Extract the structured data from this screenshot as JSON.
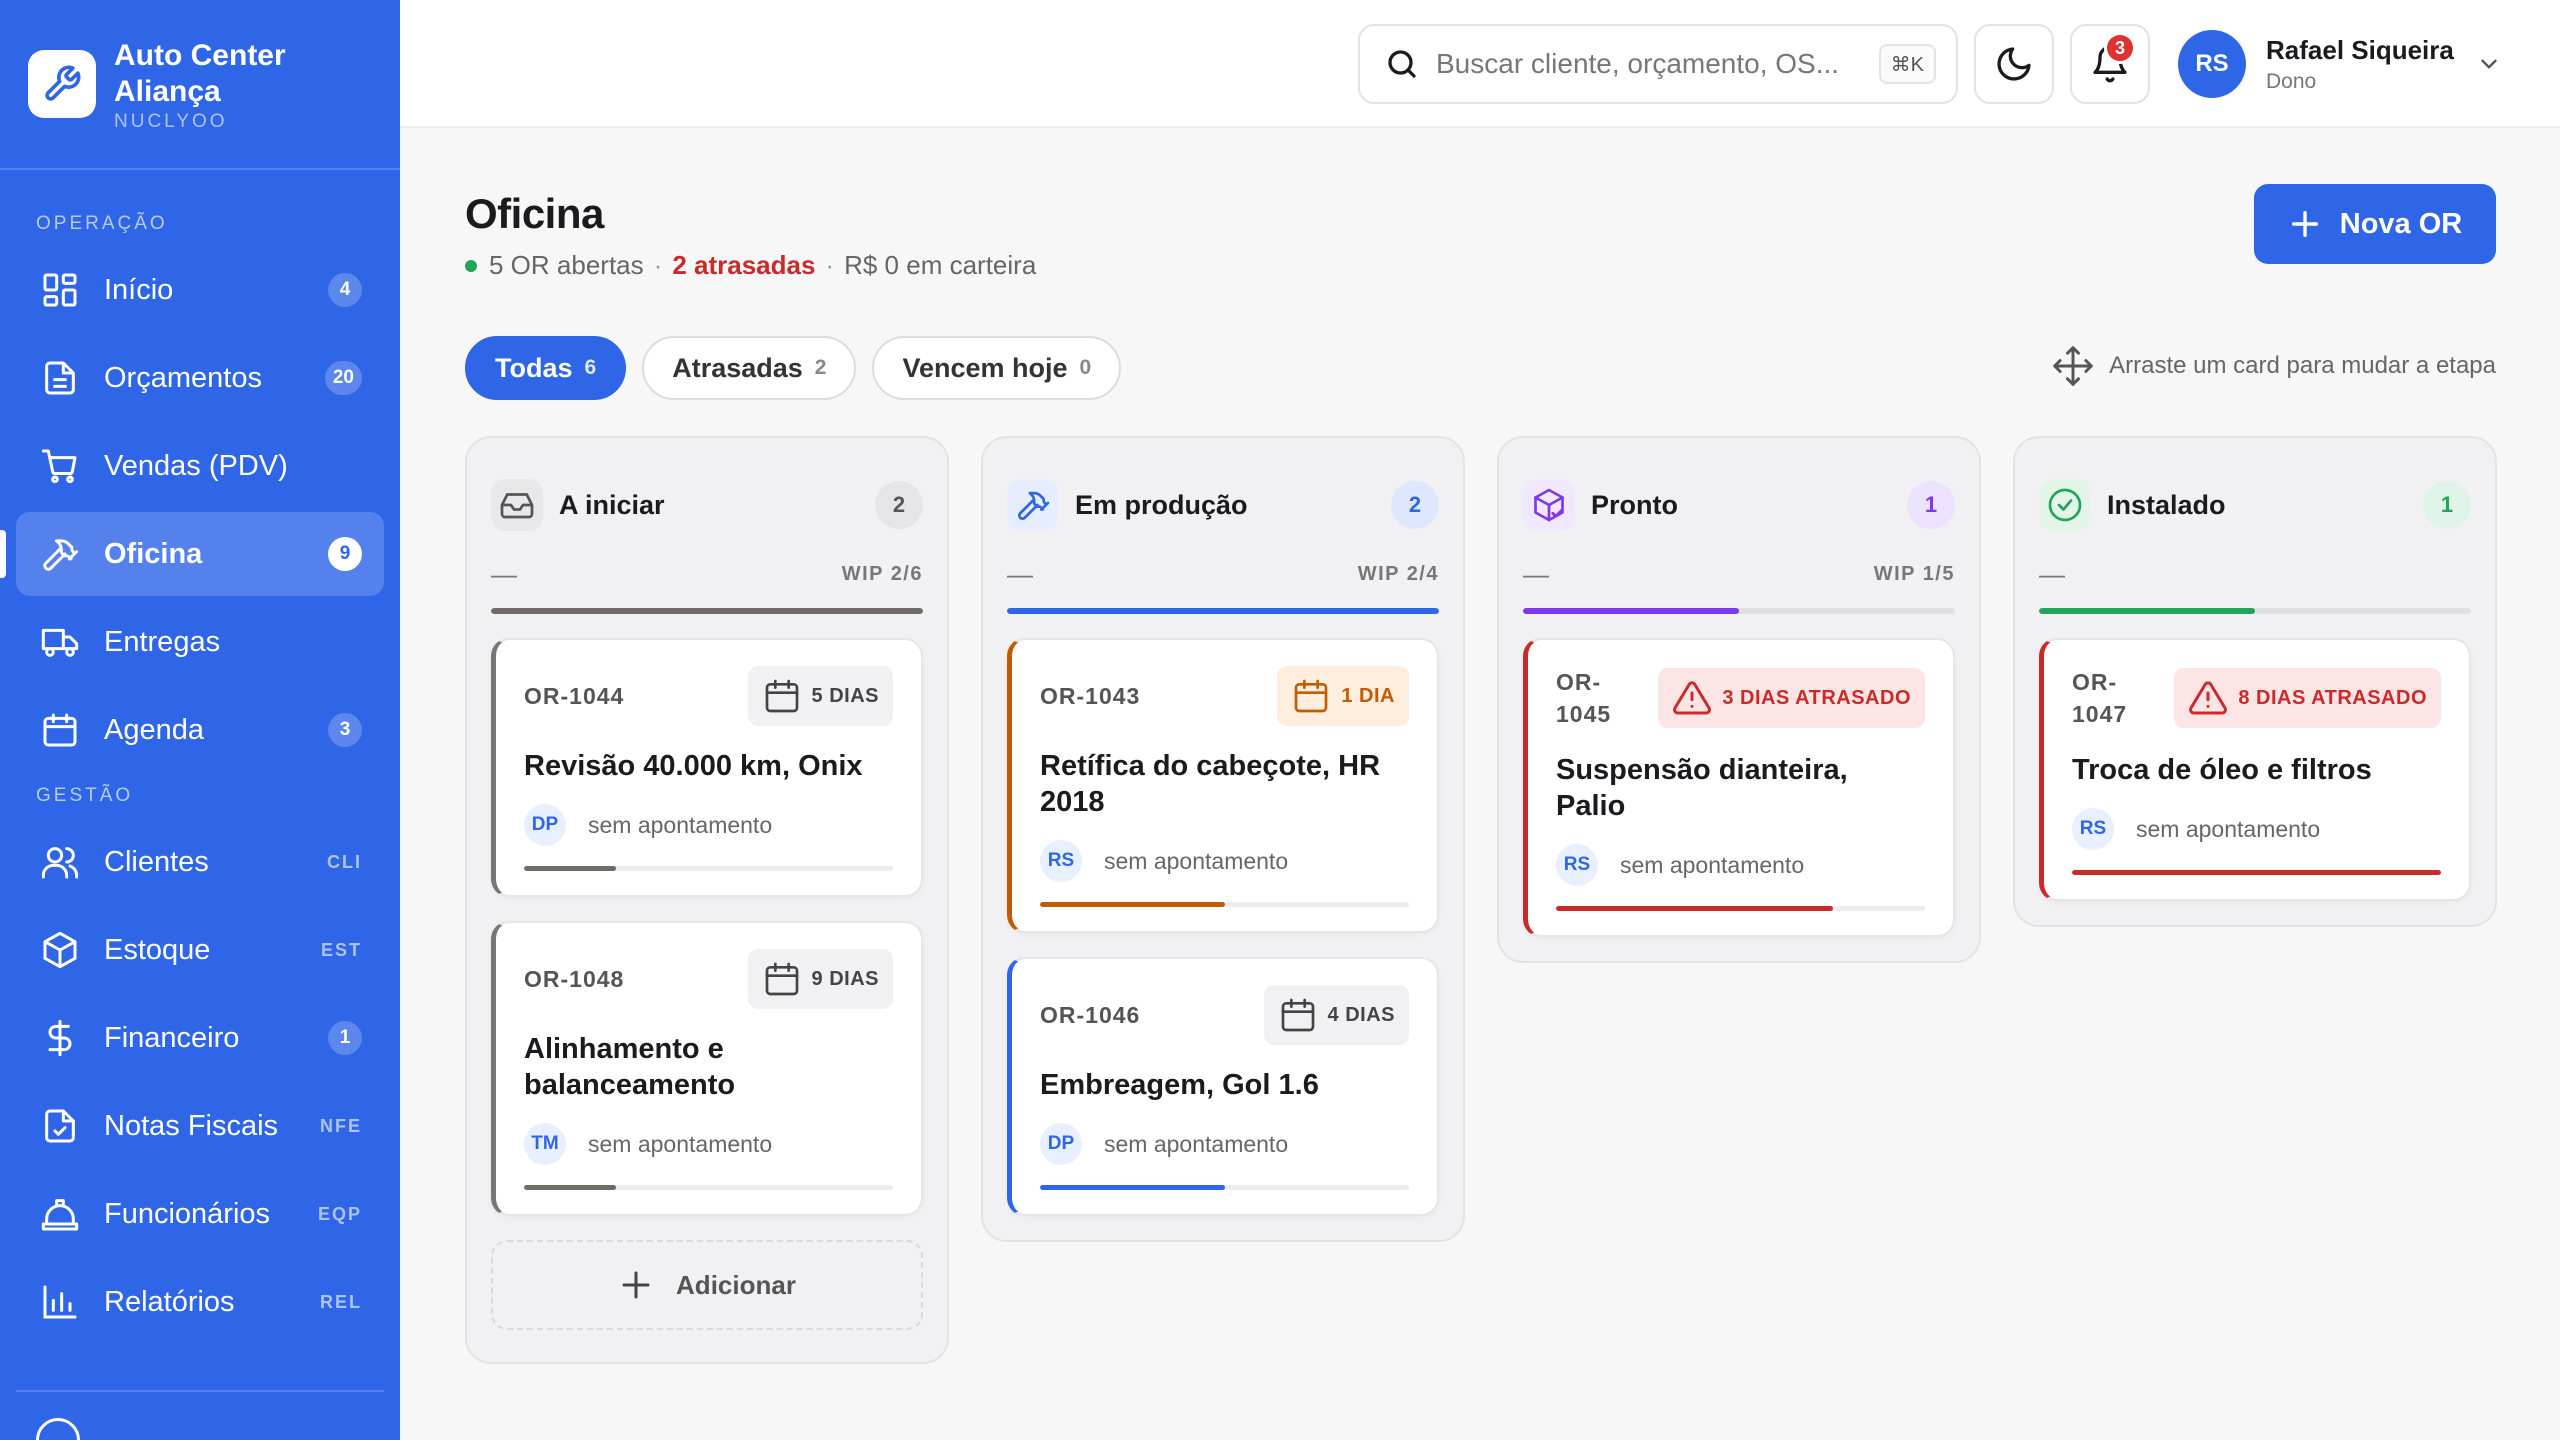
{
  "brand": {
    "name": "Auto Center Aliança",
    "sub": "NUCLYOO"
  },
  "sidebar": {
    "section_ops": "OPERAÇÃO",
    "section_mgmt": "GESTÃO",
    "items": [
      {
        "label": "Início",
        "badge": "4"
      },
      {
        "label": "Orçamentos",
        "badge": "20"
      },
      {
        "label": "Vendas (PDV)"
      },
      {
        "label": "Oficina",
        "badge": "9"
      },
      {
        "label": "Entregas"
      },
      {
        "label": "Agenda",
        "badge": "3"
      },
      {
        "label": "Clientes",
        "code": "CLI"
      },
      {
        "label": "Estoque",
        "code": "EST"
      },
      {
        "label": "Financeiro",
        "badge": "1"
      },
      {
        "label": "Notas Fiscais",
        "code": "NFE"
      },
      {
        "label": "Funcionários",
        "code": "EQP"
      },
      {
        "label": "Relatórios",
        "code": "REL"
      }
    ]
  },
  "topbar": {
    "search_placeholder": "Buscar cliente, orçamento, OS...",
    "search_kbd": "⌘K",
    "notif_count": "3",
    "user": {
      "initials": "RS",
      "name": "Rafael Siqueira",
      "role": "Dono"
    }
  },
  "page": {
    "title": "Oficina",
    "meta_open": "5 OR abertas",
    "meta_sep": "·",
    "meta_late": "2 atrasadas",
    "meta_wallet": "R$ 0 em carteira",
    "new_button": "Nova OR",
    "drag_hint": "Arraste um card para mudar a etapa"
  },
  "filters": [
    {
      "label": "Todas",
      "count": "6"
    },
    {
      "label": "Atrasadas",
      "count": "2"
    },
    {
      "label": "Vencem hoje",
      "count": "0"
    }
  ],
  "colors": {
    "primary": "#2f66e8",
    "danger": "#c92a2a",
    "warn": "#c25c00",
    "success": "#22a559",
    "purple": "#7c3aed",
    "neutral": "#777777"
  },
  "columns": [
    {
      "title": "A iniciar",
      "count": "2",
      "dash": "—",
      "wip": "WIP 2/6",
      "wip_fill": 1.0,
      "cards": [
        {
          "id": "OR-1044",
          "due": "5 DIAS",
          "title": "Revisão 40.000 km, Onix",
          "initials": "DP",
          "assign": "sem apontamento",
          "progress": 0.25
        },
        {
          "id": "OR-1048",
          "due": "9 DIAS",
          "title": "Alinhamento e balanceamento",
          "initials": "TM",
          "assign": "sem apontamento",
          "progress": 0.25
        }
      ],
      "add_label": "Adicionar"
    },
    {
      "title": "Em produção",
      "count": "2",
      "dash": "—",
      "wip": "WIP 2/4",
      "wip_fill": 1.0,
      "cards": [
        {
          "id": "OR-1043",
          "due": "1 DIA",
          "title": "Retífica do cabeçote, HR 2018",
          "initials": "RS",
          "assign": "sem apontamento",
          "progress": 0.5
        },
        {
          "id": "OR-1046",
          "due": "4 DIAS",
          "title": "Embreagem, Gol 1.6",
          "initials": "DP",
          "assign": "sem apontamento",
          "progress": 0.5
        }
      ]
    },
    {
      "title": "Pronto",
      "count": "1",
      "dash": "—",
      "wip": "WIP 1/5",
      "wip_fill": 0.5,
      "cards": [
        {
          "id": "OR-1045",
          "due": "3 DIAS ATRASADO",
          "title": "Suspensão dianteira, Palio",
          "initials": "RS",
          "assign": "sem apontamento",
          "progress": 0.75
        }
      ]
    },
    {
      "title": "Instalado",
      "count": "1",
      "dash": "—",
      "wip": "",
      "wip_fill": 0.5,
      "cards": [
        {
          "id": "OR-1047",
          "due": "8 DIAS ATRASADO",
          "title": "Troca de óleo e filtros",
          "initials": "RS",
          "assign": "sem apontamento",
          "progress": 1.0
        }
      ]
    }
  ]
}
